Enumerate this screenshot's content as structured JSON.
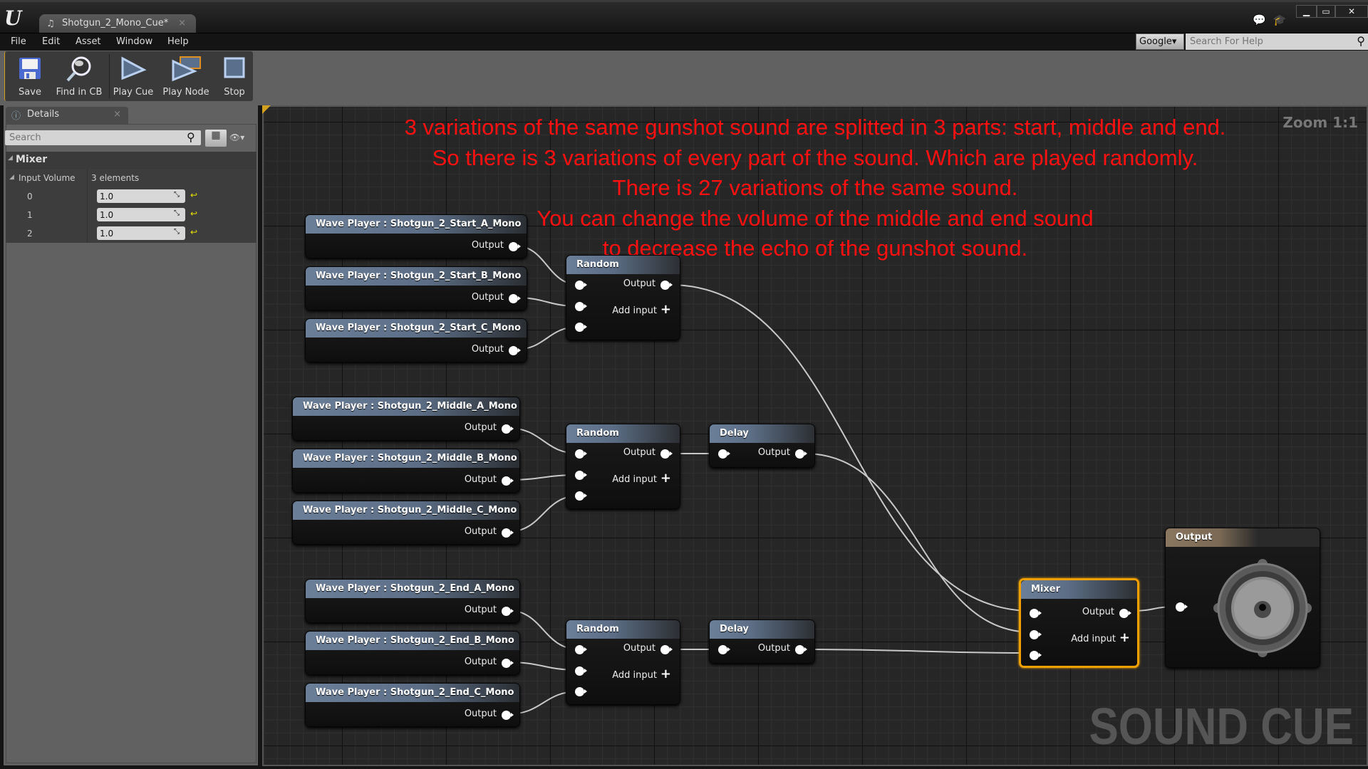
{
  "app": {
    "logo": "U",
    "tab_title": "Shotgun_2_Mono_Cue*",
    "tab_close": "×"
  },
  "window_controls": {
    "minimize": "▁",
    "maximize": "▭",
    "close": "✕"
  },
  "menu": [
    "File",
    "Edit",
    "Asset",
    "Window",
    "Help"
  ],
  "help_search": {
    "provider": "Google▾",
    "placeholder": "Search For Help"
  },
  "toolbar": {
    "save": "Save",
    "find_in_cb": "Find in CB",
    "play_cue": "Play Cue",
    "play_node": "Play Node",
    "stop": "Stop"
  },
  "details": {
    "tab_label": "Details",
    "tab_close": "×",
    "search_placeholder": "Search",
    "category": "Mixer",
    "property": {
      "name": "Input Volume",
      "summary": "3 elements"
    },
    "elements": [
      {
        "index": "0",
        "value": "1.0"
      },
      {
        "index": "1",
        "value": "1.0"
      },
      {
        "index": "2",
        "value": "1.0"
      }
    ]
  },
  "graph": {
    "zoom_label": "Zoom 1:1",
    "watermark": "SOUND CUE",
    "note_lines": [
      "3 variations of the same gunshot sound are splitted in 3 parts: start, middle and end.",
      "So there is 3 variations of every part of the sound. Which are played randomly.",
      "There is 27 variations of the same sound.",
      "You can change the volume of the middle and end sound",
      "to decrease the echo of the gunshot sound."
    ],
    "pin_output": "Output",
    "add_input": "Add input",
    "wave_players": [
      "Wave Player : Shotgun_2_Start_A_Mono",
      "Wave Player : Shotgun_2_Start_B_Mono",
      "Wave Player : Shotgun_2_Start_C_Mono",
      "Wave Player : Shotgun_2_Middle_A_Mono",
      "Wave Player : Shotgun_2_Middle_B_Mono",
      "Wave Player : Shotgun_2_Middle_C_Mono",
      "Wave Player : Shotgun_2_End_A_Mono",
      "Wave Player : Shotgun_2_End_B_Mono",
      "Wave Player : Shotgun_2_End_C_Mono"
    ],
    "random_title": "Random",
    "delay_title": "Delay",
    "mixer_title": "Mixer",
    "output_title": "Output"
  }
}
